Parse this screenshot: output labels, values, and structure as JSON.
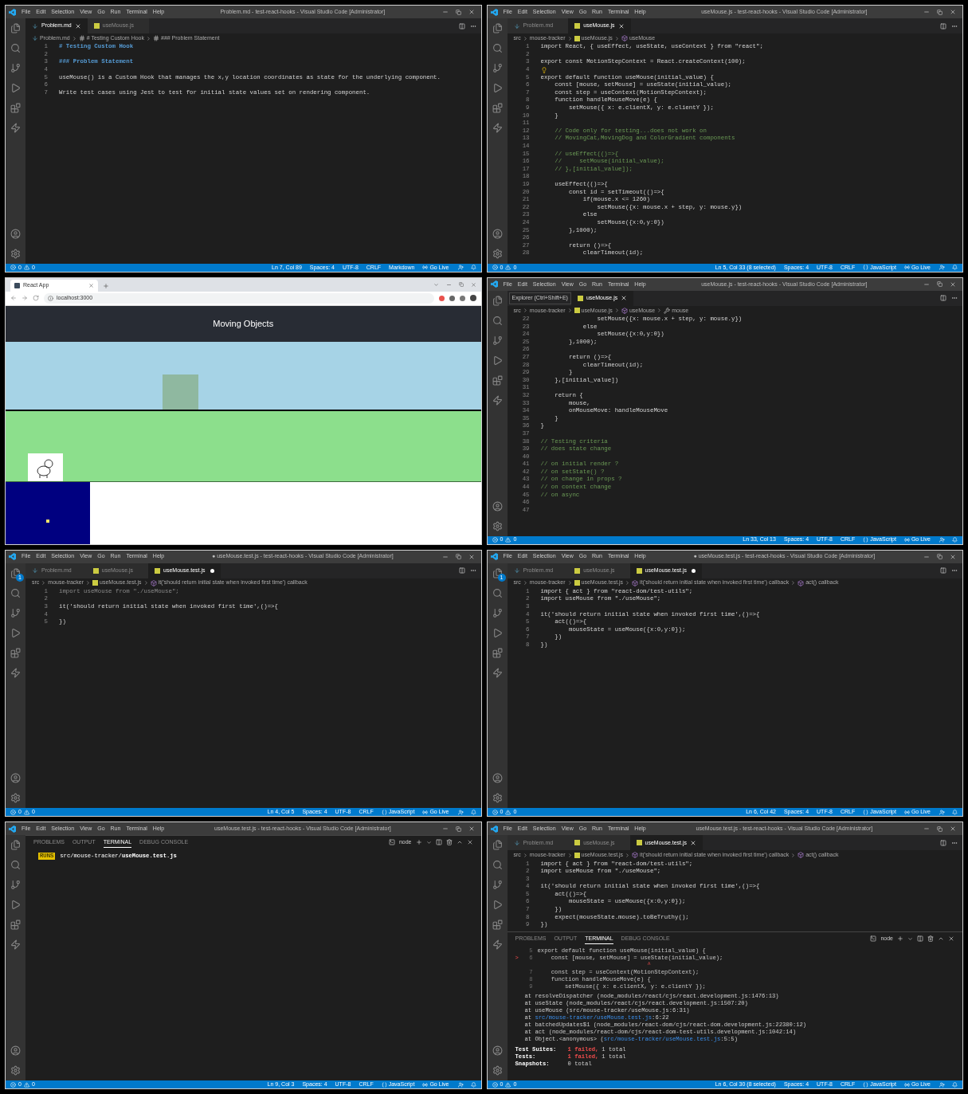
{
  "panels": [
    {
      "kind": "vscode",
      "menu": [
        "File",
        "Edit",
        "Selection",
        "View",
        "Go",
        "Run",
        "Terminal",
        "Help"
      ],
      "title": "Problem.md - test-react-hooks - Visual Studio Code [Administrator]",
      "editor": {
        "tabs": [
          {
            "label": "Problem.md",
            "kind": "md",
            "selected": true,
            "dirty": false
          },
          {
            "label": "useMouse.js",
            "kind": "js",
            "selected": false,
            "dirty": false
          }
        ],
        "breadcrumbs": [
          {
            "label": "Problem.md",
            "kind": "md"
          },
          {
            "label": "# Testing Custom Hook",
            "kind": "section"
          },
          {
            "label": "### Problem Statement",
            "kind": "section"
          }
        ],
        "lines": [
          {
            "n": "1",
            "text": "# Testing Custom Hook",
            "kind": "heading"
          },
          {
            "n": "2"
          },
          {
            "n": "3",
            "text": "### Problem Statement",
            "kind": "heading"
          },
          {
            "n": "4"
          },
          {
            "n": "5",
            "text": "useMouse() is a Custom Hook that manages the x,y location coordinates as state for the underlying component."
          },
          {
            "n": "6"
          },
          {
            "n": "7",
            "text": "Write test cases using Jest to test for initial state values set on rendering component."
          }
        ]
      },
      "status": {
        "errors": "0",
        "warnings": "0",
        "items": [
          {
            "text": "Ln 7, Col 89",
            "kind": "text"
          },
          {
            "text": "Spaces: 4",
            "kind": "text"
          },
          {
            "text": "UTF-8",
            "kind": "text"
          },
          {
            "text": "CRLF",
            "kind": "text"
          },
          {
            "text": "Markdown",
            "kind": "text"
          },
          {
            "text": "Go Live",
            "kind": "broadcast"
          }
        ]
      }
    },
    {
      "kind": "vscode",
      "menu": [
        "File",
        "Edit",
        "Selection",
        "View",
        "Go",
        "Run",
        "Terminal",
        "Help"
      ],
      "title": "useMouse.js - test-react-hooks - Visual Studio Code [Administrator]",
      "editor": {
        "tabs": [
          {
            "label": "Problem.md",
            "kind": "md",
            "selected": false,
            "dirty": false
          },
          {
            "label": "useMouse.js",
            "kind": "js",
            "selected": true,
            "dirty": false
          }
        ],
        "breadcrumbs": [
          {
            "label": "src",
            "kind": "folder"
          },
          {
            "label": "mouse-tracker",
            "kind": "folder"
          },
          {
            "label": "useMouse.js",
            "kind": "js"
          },
          {
            "label": "useMouse",
            "kind": "symbol"
          }
        ],
        "lines": [
          {
            "n": "1",
            "text": "import React, { useEffect, useState, useContext } from \"react\";"
          },
          {
            "n": "2"
          },
          {
            "n": "3",
            "text": "export const MotionStepContext = React.createContext(100);"
          },
          {
            "n": "4",
            "bulb": true
          },
          {
            "n": "5",
            "text": "export default function useMouse(initial_value) {"
          },
          {
            "n": "6",
            "text": "    const [mouse, setMouse] = useState(initial_value);"
          },
          {
            "n": "7",
            "text": "    const step = useContext(MotionStepContext);"
          },
          {
            "n": "8",
            "text": "    function handleMouseMove(e) {"
          },
          {
            "n": "9",
            "text": "        setMouse({ x: e.clientX, y: e.clientY });"
          },
          {
            "n": "10",
            "text": "    }"
          },
          {
            "n": "11"
          },
          {
            "n": "12",
            "text": "    // Code only for testing...does not work on",
            "kind": "comment"
          },
          {
            "n": "13",
            "text": "    // MovingCat,MovingDog and ColorGradient components",
            "kind": "comment"
          },
          {
            "n": "14"
          },
          {
            "n": "15",
            "text": "    // useEffect(()=>{",
            "kind": "comment"
          },
          {
            "n": "16",
            "text": "    //     setMouse(initial_value);",
            "kind": "comment"
          },
          {
            "n": "17",
            "text": "    // },[initial_value]);",
            "kind": "comment"
          },
          {
            "n": "18"
          },
          {
            "n": "19",
            "text": "    useEffect(()=>{"
          },
          {
            "n": "20",
            "text": "        const id = setTimeout(()=>{"
          },
          {
            "n": "21",
            "text": "            if(mouse.x <= 1260)"
          },
          {
            "n": "22",
            "text": "                setMouse({x: mouse.x + step, y: mouse.y})"
          },
          {
            "n": "23",
            "text": "            else"
          },
          {
            "n": "24",
            "text": "                setMouse({x:0,y:0})"
          },
          {
            "n": "25",
            "text": "        },1000);"
          },
          {
            "n": "26"
          },
          {
            "n": "27",
            "text": "        return ()=>{"
          },
          {
            "n": "28",
            "text": "            clearTimeout(id);"
          }
        ]
      },
      "status": {
        "errors": "0",
        "warnings": "0",
        "items": [
          {
            "text": "Ln 5, Col 33 (8 selected)",
            "kind": "text"
          },
          {
            "text": "Spaces: 4",
            "kind": "text"
          },
          {
            "text": "UTF-8",
            "kind": "text"
          },
          {
            "text": "CRLF",
            "kind": "text"
          },
          {
            "text": "JavaScript",
            "kind": "brace"
          },
          {
            "text": "Go Live",
            "kind": "broadcast"
          }
        ]
      }
    },
    {
      "kind": "browser",
      "tab": "React App",
      "url": "localhost:3000",
      "heading": "Moving Objects"
    },
    {
      "kind": "vscode",
      "menu": [
        "File",
        "Edit",
        "Selection",
        "View",
        "Go",
        "Run",
        "Terminal",
        "Help"
      ],
      "title": "useMouse.js - test-react-hooks - Visual Studio Code [Administrator]",
      "tooltip": "Explorer (Ctrl+Shift+E)",
      "editor": {
        "tabs": [
          {
            "label": "useMouse.js",
            "kind": "js",
            "selected": true,
            "dirty": false
          }
        ],
        "breadcrumbs": [
          {
            "label": "src",
            "kind": "folder"
          },
          {
            "label": "mouse-tracker",
            "kind": "folder"
          },
          {
            "label": "useMouse.js",
            "kind": "js"
          },
          {
            "label": "useMouse",
            "kind": "symbol"
          },
          {
            "label": "mouse",
            "kind": "variable"
          }
        ],
        "lines": [
          {
            "n": "22",
            "text": "                setMouse({x: mouse.x + step, y: mouse.y})"
          },
          {
            "n": "23",
            "text": "            else"
          },
          {
            "n": "24",
            "text": "                setMouse({x:0,y:0})"
          },
          {
            "n": "25",
            "text": "        },1000);"
          },
          {
            "n": "26"
          },
          {
            "n": "27",
            "text": "        return ()=>{"
          },
          {
            "n": "28",
            "text": "            clearTimeout(id);"
          },
          {
            "n": "29",
            "text": "        }"
          },
          {
            "n": "30",
            "text": "    },[initial_value])"
          },
          {
            "n": "31"
          },
          {
            "n": "32",
            "text": "    return {"
          },
          {
            "n": "33",
            "text": "        mouse,"
          },
          {
            "n": "34",
            "text": "        onMouseMove: handleMouseMove"
          },
          {
            "n": "35",
            "text": "    }"
          },
          {
            "n": "36",
            "text": "}"
          },
          {
            "n": "37"
          },
          {
            "n": "38",
            "text": "// Testing criteria",
            "kind": "comment"
          },
          {
            "n": "39",
            "text": "// does state change",
            "kind": "comment"
          },
          {
            "n": "40"
          },
          {
            "n": "41",
            "text": "// on initial render ?",
            "kind": "comment"
          },
          {
            "n": "42",
            "text": "// on setState() ?",
            "kind": "comment"
          },
          {
            "n": "43",
            "text": "// on change in props ?",
            "kind": "comment"
          },
          {
            "n": "44",
            "text": "// on context change",
            "kind": "comment"
          },
          {
            "n": "45",
            "text": "// on async",
            "kind": "comment"
          },
          {
            "n": "46"
          },
          {
            "n": "47"
          }
        ]
      },
      "status": {
        "errors": "0",
        "warnings": "0",
        "items": [
          {
            "text": "Ln 33, Col 13",
            "kind": "text"
          },
          {
            "text": "Spaces: 4",
            "kind": "text"
          },
          {
            "text": "UTF-8",
            "kind": "text"
          },
          {
            "text": "CRLF",
            "kind": "text"
          },
          {
            "text": "JavaScript",
            "kind": "brace"
          },
          {
            "text": "Go Live",
            "kind": "broadcast"
          }
        ]
      }
    },
    {
      "kind": "vscode",
      "menu": [
        "File",
        "Edit",
        "Selection",
        "View",
        "Go",
        "Run",
        "Terminal",
        "Help"
      ],
      "title": "● useMouse.test.js - test-react-hooks - Visual Studio Code [Administrator]",
      "badge": "1",
      "editor": {
        "tabs": [
          {
            "label": "Problem.md",
            "kind": "md",
            "selected": false,
            "dirty": false
          },
          {
            "label": "useMouse.js",
            "kind": "js",
            "selected": false,
            "dirty": false
          },
          {
            "label": "useMouse.test.js",
            "kind": "js",
            "selected": true,
            "dirty": true
          }
        ],
        "breadcrumbs": [
          {
            "label": "src",
            "kind": "folder"
          },
          {
            "label": "mouse-tracker",
            "kind": "folder"
          },
          {
            "label": "useMouse.test.js",
            "kind": "js"
          },
          {
            "label": "it('should return initial state when invoked first time') callback",
            "kind": "symbol"
          }
        ],
        "lines": [
          {
            "n": "1",
            "text": "import useMouse from \"./useMouse\";",
            "kind": "unused"
          },
          {
            "n": "2"
          },
          {
            "n": "3",
            "text": "it('should return initial state when invoked first time',()=>{"
          },
          {
            "n": "4"
          },
          {
            "n": "5",
            "text": "})"
          }
        ]
      },
      "status": {
        "errors": "0",
        "warnings": "0",
        "items": [
          {
            "text": "Ln 4, Col 5",
            "kind": "text"
          },
          {
            "text": "Spaces: 4",
            "kind": "text"
          },
          {
            "text": "UTF-8",
            "kind": "text"
          },
          {
            "text": "CRLF",
            "kind": "text"
          },
          {
            "text": "JavaScript",
            "kind": "brace"
          },
          {
            "text": "Go Live",
            "kind": "broadcast"
          }
        ]
      }
    },
    {
      "kind": "vscode",
      "menu": [
        "File",
        "Edit",
        "Selection",
        "View",
        "Go",
        "Run",
        "Terminal",
        "Help"
      ],
      "title": "● useMouse.test.js - test-react-hooks - Visual Studio Code [Administrator]",
      "badge": "1",
      "editor": {
        "tabs": [
          {
            "label": "Problem.md",
            "kind": "md",
            "selected": false,
            "dirty": false
          },
          {
            "label": "useMouse.js",
            "kind": "js",
            "selected": false,
            "dirty": false
          },
          {
            "label": "useMouse.test.js",
            "kind": "js",
            "selected": true,
            "dirty": true
          }
        ],
        "breadcrumbs": [
          {
            "label": "src",
            "kind": "folder"
          },
          {
            "label": "mouse-tracker",
            "kind": "folder"
          },
          {
            "label": "useMouse.test.js",
            "kind": "js"
          },
          {
            "label": "it('should return initial state when invoked first time') callback",
            "kind": "symbol"
          },
          {
            "label": "act() callback",
            "kind": "symbol"
          }
        ],
        "lines": [
          {
            "n": "1",
            "text": "import { act } from \"react-dom/test-utils\";"
          },
          {
            "n": "2",
            "text": "import useMouse from \"./useMouse\";"
          },
          {
            "n": "3"
          },
          {
            "n": "4",
            "text": "it('should return initial state when invoked first time',()=>{"
          },
          {
            "n": "5",
            "text": "    act(()=>{"
          },
          {
            "n": "6",
            "text": "        mouseState = useMouse({x:0,y:0});"
          },
          {
            "n": "7",
            "text": "    })"
          },
          {
            "n": "8",
            "text": "})"
          }
        ]
      },
      "status": {
        "errors": "0",
        "warnings": "0",
        "items": [
          {
            "text": "Ln 6, Col 42",
            "kind": "text"
          },
          {
            "text": "Spaces: 4",
            "kind": "text"
          },
          {
            "text": "UTF-8",
            "kind": "text"
          },
          {
            "text": "CRLF",
            "kind": "text"
          },
          {
            "text": "JavaScript",
            "kind": "brace"
          },
          {
            "text": "Go Live",
            "kind": "broadcast"
          }
        ]
      }
    },
    {
      "kind": "vscode",
      "menu": [
        "File",
        "Edit",
        "Selection",
        "View",
        "Go",
        "Run",
        "Terminal",
        "Help"
      ],
      "title": "useMouse.test.js - test-react-hooks - Visual Studio Code [Administrator]",
      "terminal": {
        "tabs": [
          {
            "label": "PROBLEMS",
            "selected": false
          },
          {
            "label": "OUTPUT",
            "selected": false
          },
          {
            "label": "TERMINAL",
            "selected": true
          },
          {
            "label": "DEBUG CONSOLE",
            "selected": false
          }
        ],
        "shell": "node",
        "runs": {
          "badge": "RUNS",
          "path": "src/mouse-tracker/**useMouse.test.js**"
        }
      },
      "status": {
        "errors": "0",
        "warnings": "0",
        "items": [
          {
            "text": "Ln 9, Col 3",
            "kind": "text"
          },
          {
            "text": "Spaces: 4",
            "kind": "text"
          },
          {
            "text": "UTF-8",
            "kind": "text"
          },
          {
            "text": "CRLF",
            "kind": "text"
          },
          {
            "text": "JavaScript",
            "kind": "brace"
          },
          {
            "text": "Go Live",
            "kind": "broadcast"
          }
        ]
      }
    },
    {
      "kind": "vscode",
      "menu": [
        "File",
        "Edit",
        "Selection",
        "View",
        "Go",
        "Run",
        "Terminal",
        "Help"
      ],
      "title": "useMouse.test.js - test-react-hooks - Visual Studio Code [Administrator]",
      "editor": {
        "tabs": [
          {
            "label": "Problem.md",
            "kind": "md",
            "selected": false,
            "dirty": false
          },
          {
            "label": "useMouse.js",
            "kind": "js",
            "selected": false,
            "dirty": false
          },
          {
            "label": "useMouse.test.js",
            "kind": "js",
            "selected": true,
            "dirty": false
          }
        ],
        "breadcrumbs": [
          {
            "label": "src",
            "kind": "folder"
          },
          {
            "label": "mouse-tracker",
            "kind": "folder"
          },
          {
            "label": "useMouse.test.js",
            "kind": "js"
          },
          {
            "label": "it('should return initial state when invoked first time') callback",
            "kind": "symbol"
          },
          {
            "label": "act() callback",
            "kind": "symbol"
          }
        ],
        "lines": [
          {
            "n": "1",
            "text": "import { act } from \"react-dom/test-utils\";"
          },
          {
            "n": "2",
            "text": "import useMouse from \"./useMouse\";"
          },
          {
            "n": "3"
          },
          {
            "n": "4",
            "text": "it('should return initial state when invoked first time',()=>{"
          },
          {
            "n": "5",
            "text": "    act(()=>{"
          },
          {
            "n": "6",
            "text": "        mouseState = useMouse({x:0,y:0});"
          },
          {
            "n": "7",
            "text": "    })"
          },
          {
            "n": "8",
            "text": "    expect(mouseState.mouse).toBeTruthy();"
          },
          {
            "n": "9",
            "text": "})"
          }
        ]
      },
      "terminal": {
        "tabs": [
          {
            "label": "PROBLEMS",
            "selected": false
          },
          {
            "label": "OUTPUT",
            "selected": false
          },
          {
            "label": "TERMINAL",
            "selected": true
          },
          {
            "label": "DEBUG CONSOLE",
            "selected": false
          }
        ],
        "shell": "node",
        "frame": [
          {
            "n": "5",
            "text": "export default function useMouse(initial_value) {"
          },
          {
            "n": "6",
            "marker": ">",
            "text": "    const [mouse, setMouse] = useState(initial_value);"
          },
          {
            "text": "                                ^"
          },
          {
            "n": "7",
            "text": "    const step = useContext(MotionStepContext);"
          },
          {
            "n": "8",
            "text": "    function handleMouseMove(e) {"
          },
          {
            "n": "9",
            "text": "        setMouse({ x: e.clientX, y: e.clientY });"
          }
        ],
        "stack": [
          {
            "text": "at resolveDispatcher (node_modules/react/cjs/react.development.js:1476:13)"
          },
          {
            "text": "at useState (node_modules/react/cjs/react.development.js:1507:20)"
          },
          {
            "text": "at useMouse (src/mouse-tracker/useMouse.js:6:31)"
          },
          {
            "text": "at ",
            "link": "src/mouse-tracker/useMouse.test.js",
            "rest": ":6:22"
          },
          {
            "text": "at batchedUpdates$1 (node_modules/react-dom/cjs/react-dom.development.js:22380:12)"
          },
          {
            "text": "at act (node_modules/react-dom/cjs/react-dom-test-utils.development.js:1042:14)"
          },
          {
            "text": "at Object.<anonymous> (",
            "link": "src/mouse-tracker/useMouse.test.js",
            "rest": ":5:5)"
          }
        ],
        "summary": [
          {
            "label": "Test Suites:",
            "failed": "1 failed,",
            "total": "1 total"
          },
          {
            "label": "Tests:",
            "failed": "1 failed,",
            "total": "1 total"
          },
          {
            "label": "Snapshots:",
            "total": "0 total"
          }
        ]
      },
      "status": {
        "errors": "0",
        "warnings": "0",
        "items": [
          {
            "text": "Ln 6, Col 30 (8 selected)",
            "kind": "text"
          },
          {
            "text": "Spaces: 4",
            "kind": "text"
          },
          {
            "text": "UTF-8",
            "kind": "text"
          },
          {
            "text": "CRLF",
            "kind": "text"
          },
          {
            "text": "JavaScript",
            "kind": "brace"
          },
          {
            "text": "Go Live",
            "kind": "broadcast"
          }
        ]
      }
    }
  ]
}
